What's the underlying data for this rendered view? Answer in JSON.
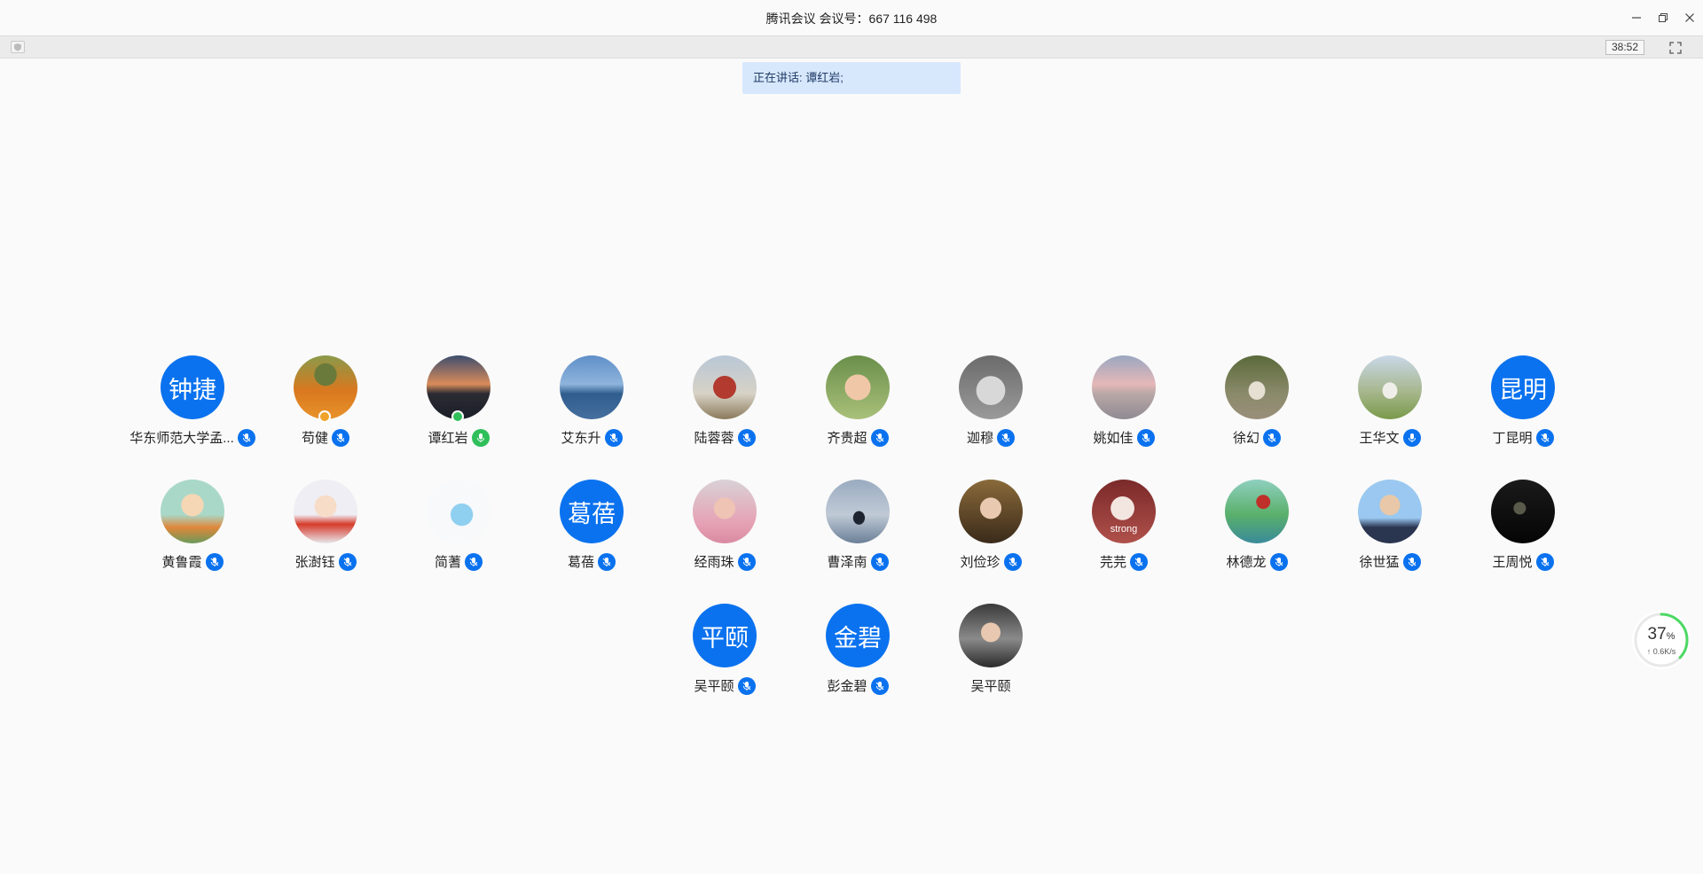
{
  "window": {
    "title": "腾讯会议 会议号：667 116 498"
  },
  "toolbar": {
    "timer": "38:52"
  },
  "speaking": {
    "text": "正在讲话: 谭红岩;"
  },
  "network": {
    "percent": "37",
    "percent_unit": "%",
    "speed": "↑ 0.6K/s",
    "level": 0.37,
    "color": "#4cd964"
  },
  "colors": {
    "accent": "#0a72ef",
    "speaking_bg": "#d7e8fc"
  },
  "participants": [
    {
      "name": "华东师范大学孟...",
      "avatar_text": "钟捷",
      "mic": "muted"
    },
    {
      "name": "苟健",
      "avatar_img": "orange-flower-field",
      "mic": "muted",
      "badge": "orange"
    },
    {
      "name": "谭红岩",
      "avatar_img": "sunset-lake",
      "mic": "speaking",
      "badge": "green"
    },
    {
      "name": "艾东升",
      "avatar_img": "blue-sea-sky",
      "mic": "muted"
    },
    {
      "name": "陆蓉蓉",
      "avatar_img": "red-robot-statue",
      "mic": "muted"
    },
    {
      "name": "齐贵超",
      "avatar_img": "child-headphones",
      "mic": "muted"
    },
    {
      "name": "迦穆",
      "avatar_img": "grey-cat",
      "mic": "muted"
    },
    {
      "name": "姚如佳",
      "avatar_img": "pink-sunset-sea",
      "mic": "muted"
    },
    {
      "name": "徐幻",
      "avatar_img": "woman-outdoors",
      "mic": "muted"
    },
    {
      "name": "王华文",
      "avatar_img": "person-on-grass",
      "mic": "on"
    },
    {
      "name": "丁昆明",
      "avatar_text": "昆明",
      "mic": "muted"
    },
    {
      "name": "黄鲁霞",
      "avatar_img": "cartoon-girl-pumpkin",
      "mic": "muted"
    },
    {
      "name": "张澍钰",
      "avatar_img": "cartoon-girl-red",
      "mic": "muted"
    },
    {
      "name": "简蓍",
      "avatar_img": "cartoon-whale",
      "mic": "muted"
    },
    {
      "name": "葛蓓",
      "avatar_text": "葛蓓",
      "mic": "muted"
    },
    {
      "name": "经雨珠",
      "avatar_img": "girl-pink-sunglasses",
      "mic": "muted"
    },
    {
      "name": "曹泽南",
      "avatar_img": "silhouette-sea",
      "mic": "muted"
    },
    {
      "name": "刘俭珍",
      "avatar_img": "woman-portrait",
      "mic": "muted"
    },
    {
      "name": "芫芫",
      "avatar_img": "cat-figure-strong",
      "avatar_caption": "strong",
      "mic": "muted"
    },
    {
      "name": "林德龙",
      "avatar_img": "ladybug-leaf",
      "mic": "muted"
    },
    {
      "name": "徐世猛",
      "avatar_img": "man-suit",
      "mic": "muted"
    },
    {
      "name": "王周悦",
      "avatar_img": "dark-photo",
      "mic": "muted"
    },
    {
      "name": "吴平颐",
      "avatar_text": "平颐",
      "mic": "muted"
    },
    {
      "name": "彭金碧",
      "avatar_text": "金碧",
      "mic": "muted"
    },
    {
      "name": "吴平颐",
      "avatar_img": "child-car",
      "mic": "none"
    }
  ]
}
